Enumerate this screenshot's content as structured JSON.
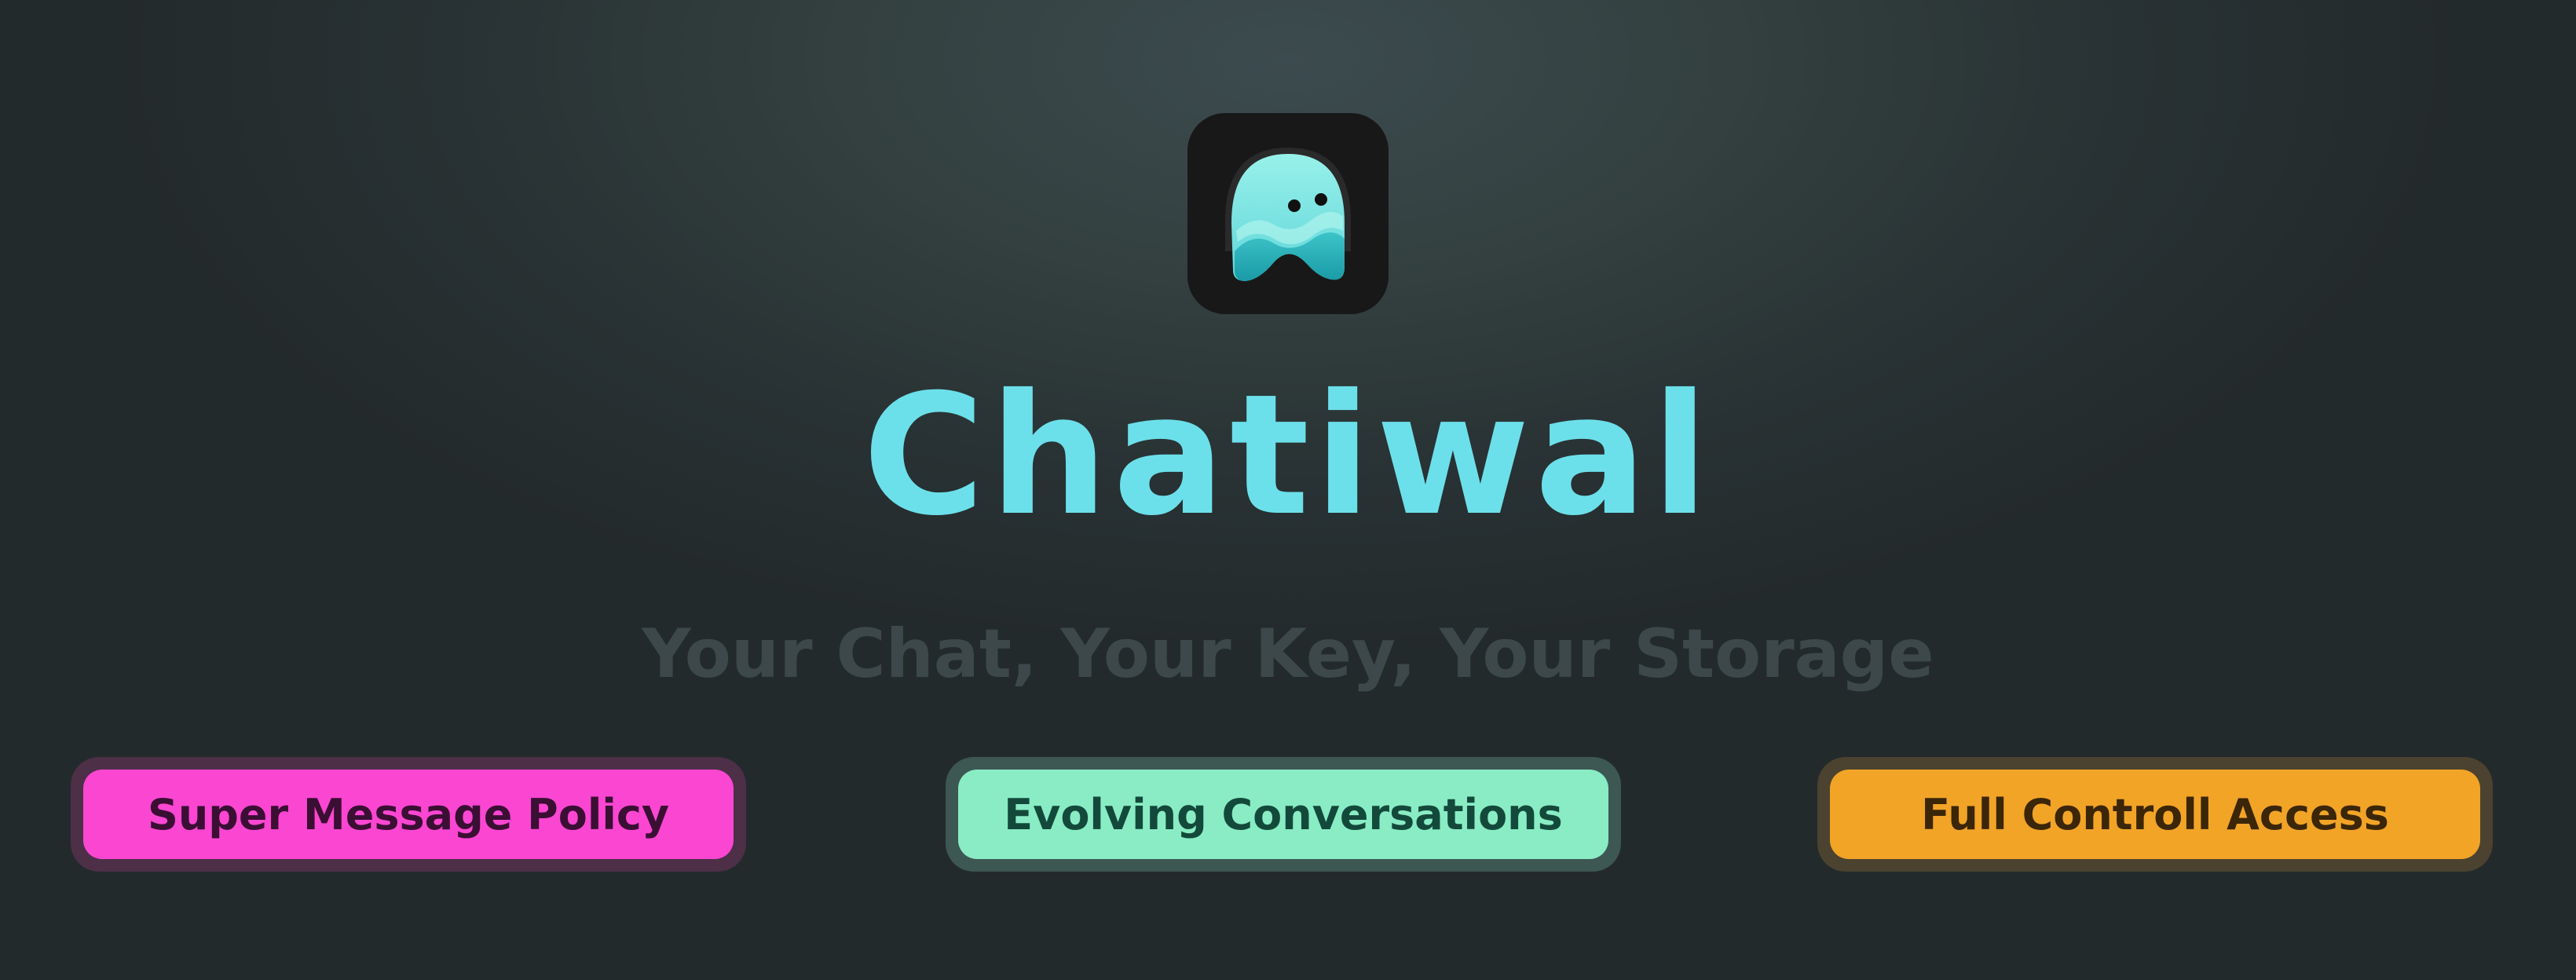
{
  "app": {
    "name": "Chatiwal",
    "tagline": "Your Chat, Your Key, Your Storage",
    "logo_icon": "ghost-chat-icon"
  },
  "features": [
    {
      "label": "Super Message Policy",
      "bg": "#fb46d2",
      "text_color": "#3a0f33"
    },
    {
      "label": "Evolving Conversations",
      "bg": "#89ecc5",
      "text_color": "#13493a"
    },
    {
      "label": "Full Controll Access",
      "bg": "#f2a427",
      "text_color": "#3b2608"
    }
  ],
  "colors": {
    "title": "#6ce0ea",
    "tagline": "#3c484a",
    "logo_bg": "#181818",
    "ghost": "#7de6e4",
    "ghost_wave": "#26aeb7"
  }
}
